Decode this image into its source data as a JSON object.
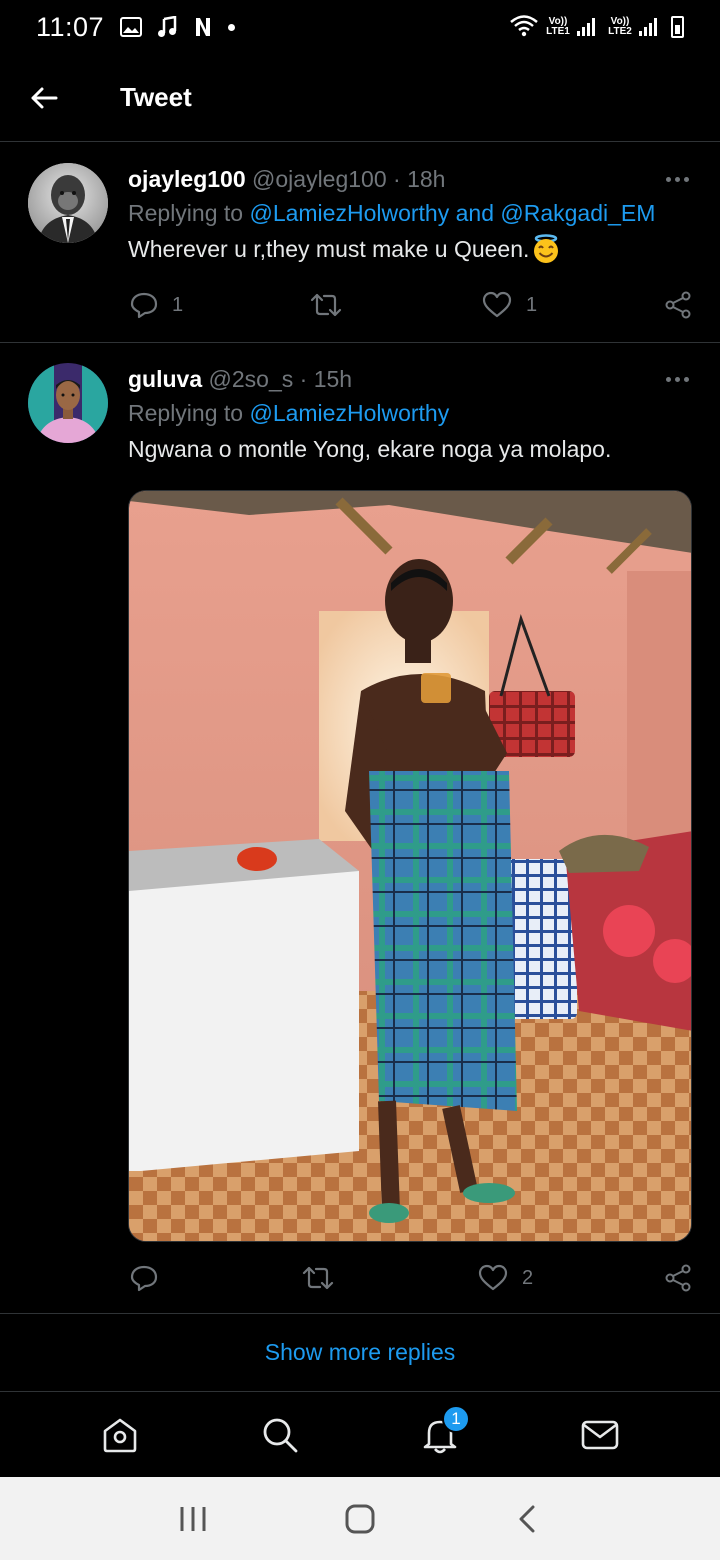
{
  "status_bar": {
    "time": "11:07",
    "notification_icons": [
      "image-icon",
      "music-note-icon",
      "netflix-icon",
      "dot-icon"
    ],
    "sim1_label": "Vo)) LTE1",
    "sim2_label": "Vo)) LTE2"
  },
  "header": {
    "title": "Tweet",
    "back_icon": "arrow-left-icon"
  },
  "replies": [
    {
      "display_name": "ojayleg100",
      "handle": "@ojayleg100",
      "time": "· 18h",
      "replying_prefix": "Replying to ",
      "mentions": [
        "@LamiezHolworthy",
        "@Rakgadi_EM"
      ],
      "mention_joiner": " and ",
      "text": "Wherever u r,they must make u Queen.",
      "emoji": "smiling-face-with-halo",
      "reply_count": "1",
      "retweet_count": "",
      "like_count": "1"
    },
    {
      "display_name": "guluva",
      "handle": "@2so_s",
      "time": "· 15h",
      "replying_prefix": "Replying to ",
      "mentions": [
        "@LamiezHolworthy"
      ],
      "text": "Ngwana o montle Yong, ekare noga ya molapo.",
      "has_photo": true,
      "reply_count": "",
      "retweet_count": "",
      "like_count": "2"
    }
  ],
  "show_more": "Show more replies",
  "bottom_nav": {
    "items": [
      "home-icon",
      "search-icon",
      "notifications-icon",
      "messages-icon"
    ],
    "notifications_badge": "1"
  },
  "colors": {
    "accent": "#1d9bf0",
    "background": "#000000",
    "muted": "#71767b",
    "divider": "#2f3336"
  }
}
